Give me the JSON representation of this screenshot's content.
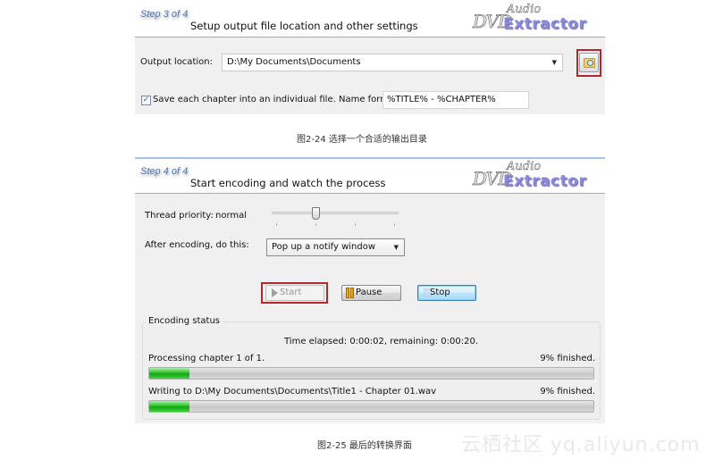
{
  "step3": {
    "step_label": "Step 3 of 4",
    "title": "Setup output file location and other settings",
    "logo": {
      "dvd": "DVD",
      "audio": "Audio",
      "extractor": "Extractor"
    },
    "output_location_label": "Output location:",
    "output_location_value": "D:\\My Documents\\Documents",
    "browse_icon": "folder-browse-icon",
    "save_chapter_checked": true,
    "save_chapter_label": "Save each chapter into an individual file. Name format",
    "name_format_value": "%TITLE% - %CHAPTER%"
  },
  "caption1": "图2-24 选择一个合适的输出目录",
  "step4": {
    "step_label": "Step 4 of 4",
    "title": "Start encoding and watch the process",
    "logo": {
      "dvd": "DVD",
      "audio": "Audio",
      "extractor": "Extractor"
    },
    "thread_priority_label": "Thread priority:",
    "thread_priority_value": "normal",
    "thread_priority_slider": {
      "position": 1,
      "min": 0,
      "max": 3
    },
    "after_encoding_label": "After encoding, do this:",
    "after_encoding_value": "Pop up a notify window",
    "buttons": {
      "start": {
        "label": "Start",
        "icon": "play-icon",
        "enabled": false
      },
      "pause": {
        "label": "Pause",
        "icon": "pause-icon",
        "enabled": true
      },
      "stop": {
        "label": "Stop",
        "icon": "stop-icon",
        "enabled": true
      }
    },
    "status": {
      "group_title": "Encoding status",
      "time_text": "Time elapsed: 0:00:02, remaining: 0:00:20.",
      "chapter_text": "Processing chapter 1 of 1.",
      "chapter_percent_text": "9% finished.",
      "chapter_progress": 9,
      "file_text": "Writing to D:\\My Documents\\Documents\\Title1 - Chapter 01.wav",
      "file_percent_text": "9% finished.",
      "file_progress": 9
    }
  },
  "caption2": "图2-25 最后的转换界面",
  "watermark": "云栖社区 yq.aliyun.com"
}
